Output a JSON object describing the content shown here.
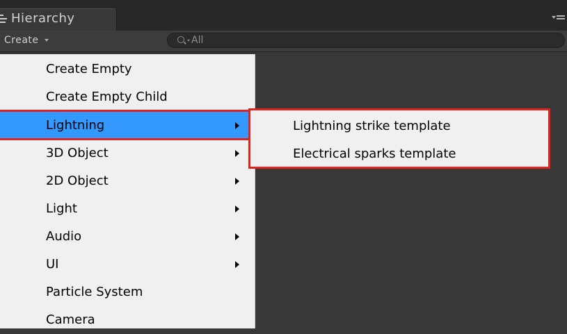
{
  "window": {
    "tab_title": "Hierarchy"
  },
  "toolbar": {
    "create_label": "Create",
    "search_value": "",
    "search_placeholder": "All"
  },
  "menu": {
    "items": [
      {
        "label": "Create Empty",
        "submenu": false
      },
      {
        "label": "Create Empty Child",
        "submenu": false
      },
      {
        "label": "Lightning",
        "submenu": true,
        "highlighted": true
      },
      {
        "label": "3D Object",
        "submenu": true
      },
      {
        "label": "2D Object",
        "submenu": true
      },
      {
        "label": "Light",
        "submenu": true
      },
      {
        "label": "Audio",
        "submenu": true
      },
      {
        "label": "UI",
        "submenu": true
      },
      {
        "label": "Particle System",
        "submenu": false
      },
      {
        "label": "Camera",
        "submenu": false
      }
    ]
  },
  "submenu": {
    "items": [
      {
        "label": "Lightning strike template"
      },
      {
        "label": "Electrical sparks template"
      }
    ]
  },
  "colors": {
    "highlight": "#3399ff",
    "callout_outline": "#e0231c",
    "menu_background": "#f0f0f0",
    "panel_background": "#383838"
  }
}
